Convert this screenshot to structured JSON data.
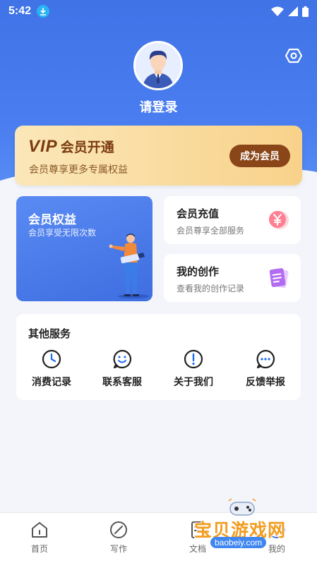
{
  "status_bar": {
    "time": "5:42"
  },
  "profile": {
    "login_label": "请登录"
  },
  "vip": {
    "title_vip": "VIP",
    "title_rest": "会员开通",
    "subtitle": "会员尊享更多专属权益",
    "button": "成为会员"
  },
  "benefit": {
    "title": "会员权益",
    "subtitle": "会员享受无限次数"
  },
  "recharge": {
    "title": "会员充值",
    "subtitle": "会员尊享全部服务"
  },
  "creation": {
    "title": "我的创作",
    "subtitle": "查看我的创作记录"
  },
  "services": {
    "title": "其他服务",
    "items": [
      {
        "label": "消费记录",
        "icon": "clock-icon"
      },
      {
        "label": "联系客服",
        "icon": "smile-chat-icon"
      },
      {
        "label": "关于我们",
        "icon": "info-exclamation-icon"
      },
      {
        "label": "反馈举报",
        "icon": "chat-dots-icon"
      }
    ]
  },
  "tabbar": {
    "items": [
      {
        "label": "首页",
        "icon": "home-icon"
      },
      {
        "label": "写作",
        "icon": "pen-circle-icon"
      },
      {
        "label": "文档",
        "icon": "document-icon"
      },
      {
        "label": "我的",
        "icon": "user-icon"
      }
    ]
  },
  "watermark": {
    "text": "宝贝游戏网",
    "url": "baobeiy.com"
  },
  "colors": {
    "primary": "#3f73e6",
    "vip_gold": "#f8d28a",
    "vip_brown": "#8a4518"
  }
}
